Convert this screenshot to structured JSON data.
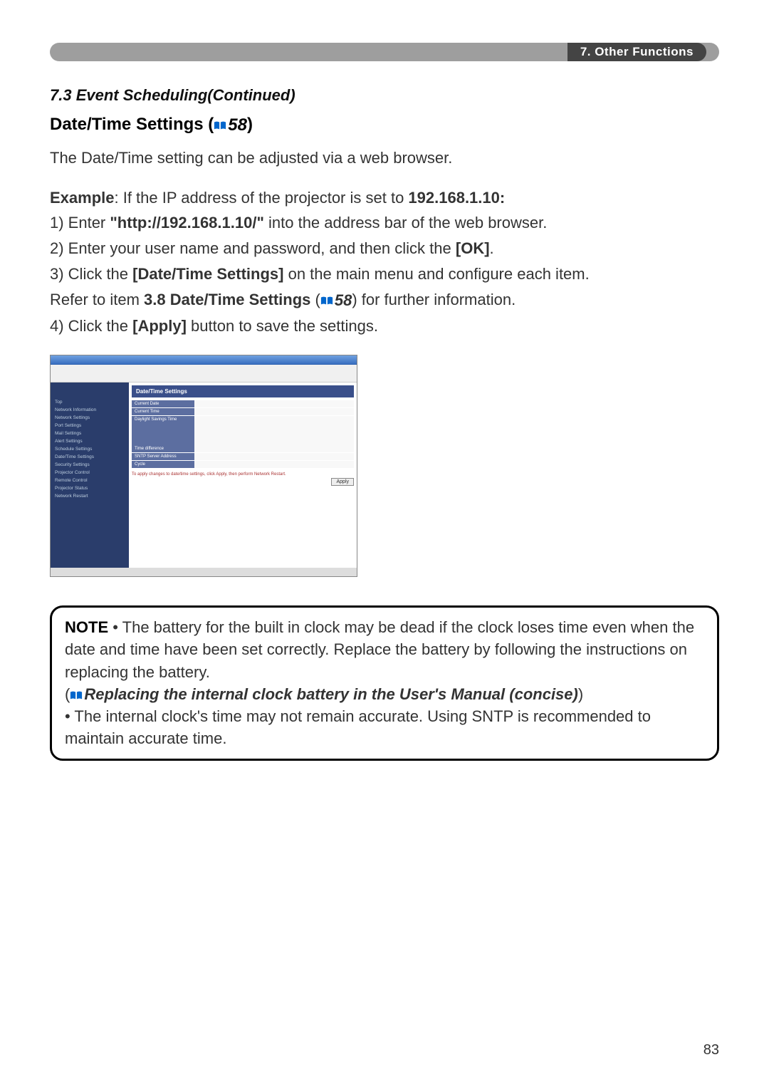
{
  "banner": {
    "section": "7. Other Functions"
  },
  "heading": {
    "section_title": "7.3 Event Scheduling(Continued)",
    "subheading_prefix": "Date/Time Settings (",
    "subheading_ref": "58",
    "subheading_suffix": ")"
  },
  "intro": "The Date/Time setting can be adjusted via a web browser.",
  "example_label": "Example",
  "example_cond": ": If the IP address of the projector is set to ",
  "example_ip": "192.168.1.10:",
  "steps": {
    "s1a": "1) Enter ",
    "s1_url": "\"http://192.168.1.10/\"",
    "s1b": " into the address bar of the web browser.",
    "s2a": "2) Enter your user name and password, and then click the ",
    "s2_btn": "[OK]",
    "s2b": ".",
    "s3a": "3) Click the ",
    "s3_btn": "[Date/Time Settings]",
    "s3b": " on the main menu and configure each item.",
    "s3_ref_a": "Refer to item ",
    "s3_ref_name": "3.8 Date/Time Settings",
    "s3_ref_open": " (",
    "s3_ref_num": "58",
    "s3_ref_close": ") for further information.",
    "s4a": "4) Click the ",
    "s4_btn": "[Apply]",
    "s4b": " button to save the settings."
  },
  "screenshot": {
    "panel_title": "Date/Time Settings",
    "side": [
      "Top",
      "Network Information",
      "Network Settings",
      "Port Settings",
      "Mail Settings",
      "Alert Settings",
      "Schedule Settings",
      "Date/Time Settings",
      "Security Settings",
      "Projector Control",
      "Remote Control",
      "Projector Status",
      "Network Restart"
    ],
    "rows": [
      "Current Date",
      "Current Time",
      "Daylight Savings Time",
      "Time difference",
      "SNTP Server Address",
      "Cycle"
    ],
    "hint": "To apply changes to date/time settings, click Apply, then perform Network Restart.",
    "apply": "Apply"
  },
  "note": {
    "lead": "NOTE",
    "p1": "  • The battery for the built in clock may be dead if the clock loses time even when the date and time have been set correctly. Replace the battery by following the instructions on replacing the battery.",
    "ref_open": "(",
    "ref_text": "Replacing the internal clock battery in the User's Manual (concise)",
    "ref_close": ")",
    "p2": "• The internal clock's time may not remain accurate. Using SNTP is recommended to maintain accurate time."
  },
  "page_number": "83"
}
